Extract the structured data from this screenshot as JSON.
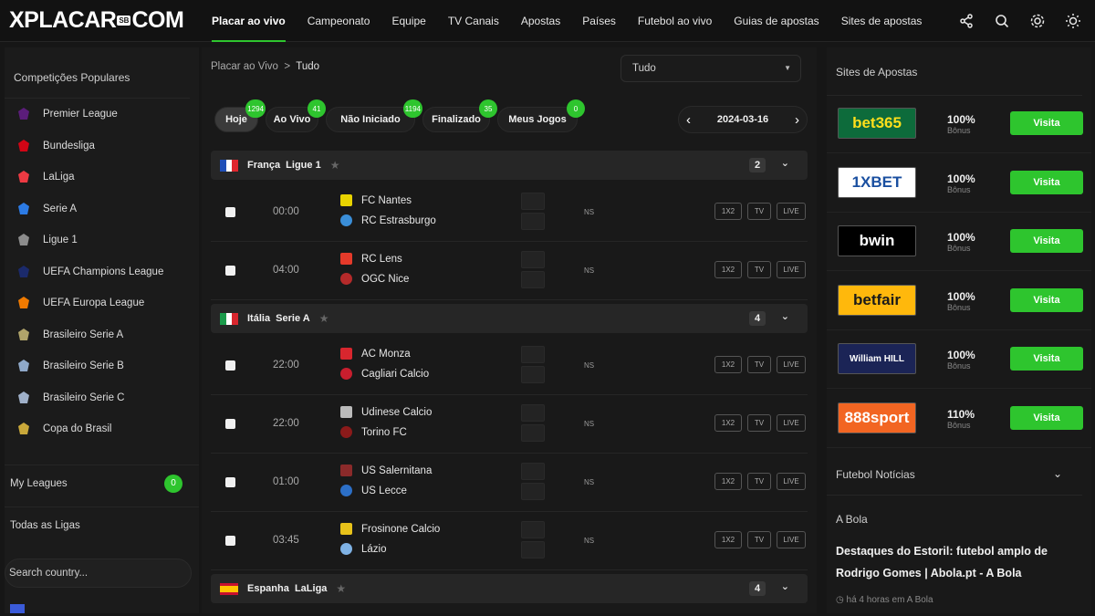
{
  "header": {
    "logo": {
      "part1": "XPLACAR",
      "badge": "SB",
      "part2": "COM"
    },
    "nav": [
      {
        "label": "Placar ao vivo",
        "active": true
      },
      {
        "label": "Campeonato"
      },
      {
        "label": "Equipe"
      },
      {
        "label": "TV Canais"
      },
      {
        "label": "Apostas"
      },
      {
        "label": "Países"
      },
      {
        "label": "Futebol ao vivo"
      },
      {
        "label": "Guias de apostas"
      },
      {
        "label": "Sites de apostas"
      }
    ],
    "icons": [
      "share-icon",
      "search-icon",
      "gear-icon",
      "sun-icon"
    ]
  },
  "sidebar": {
    "title": "Competições Populares",
    "competitions": [
      {
        "label": "Premier League",
        "icon": "premier-league-icon",
        "color": "#5b1d7a"
      },
      {
        "label": "Bundesliga",
        "icon": "bundesliga-icon",
        "color": "#d20515"
      },
      {
        "label": "LaLiga",
        "icon": "laliga-icon",
        "color": "#ee3a43"
      },
      {
        "label": "Serie A",
        "icon": "serie-a-icon",
        "color": "#2c7be5"
      },
      {
        "label": "Ligue 1",
        "icon": "ligue-1-icon",
        "color": "#8c8c8c"
      },
      {
        "label": "UEFA Champions League",
        "icon": "champions-league-icon",
        "color": "#1b2a6b"
      },
      {
        "label": "UEFA Europa League",
        "icon": "europa-league-icon",
        "color": "#f07a00"
      },
      {
        "label": "Brasileiro Serie A",
        "icon": "brasileiro-a-icon",
        "color": "#b0a46a"
      },
      {
        "label": "Brasileiro Serie B",
        "icon": "brasileiro-b-icon",
        "color": "#8fa9c9"
      },
      {
        "label": "Brasileiro Serie C",
        "icon": "brasileiro-c-icon",
        "color": "#9fb0c9"
      },
      {
        "label": "Copa do Brasil",
        "icon": "copa-do-brasil-icon",
        "color": "#c9a83a"
      }
    ],
    "my_leagues": {
      "label": "My Leagues",
      "count": "0"
    },
    "all_leagues": "Todas as Ligas",
    "search_placeholder": "Search country..."
  },
  "main": {
    "breadcrumb": {
      "root": "Placar ao Vivo",
      "separator": ">",
      "current": "Tudo"
    },
    "select_value": "Tudo",
    "filters": [
      {
        "label": "Hoje",
        "count": "1294",
        "active": true
      },
      {
        "label": "Ao Vivo",
        "count": "41"
      },
      {
        "label": "Não Iniciado",
        "count": "1194"
      },
      {
        "label": "Finalizado",
        "count": "35"
      },
      {
        "label": "Meus Jogos",
        "count": "0"
      }
    ],
    "date": "2024-03-16",
    "status_ns": "NS",
    "match_buttons": [
      "1X2",
      "TV",
      "LIVE"
    ],
    "leagues": [
      {
        "name": "França  Ligue 1",
        "count": "2",
        "flag": "france-flag",
        "matches": [
          {
            "time": "00:00",
            "home": "FC Nantes",
            "away": "RC Estrasburgo",
            "home_color": "#e8d300",
            "away_color": "#3a8ed8"
          },
          {
            "time": "04:00",
            "home": "RC Lens",
            "away": "OGC Nice",
            "home_color": "#e53a2a",
            "away_color": "#b52a2a"
          }
        ]
      },
      {
        "name": "Itália  Serie A",
        "count": "4",
        "flag": "italy-flag",
        "matches": [
          {
            "time": "22:00",
            "home": "AC Monza",
            "away": "Cagliari Calcio",
            "home_color": "#d8262e",
            "away_color": "#c81e2e"
          },
          {
            "time": "22:00",
            "home": "Udinese Calcio",
            "away": "Torino FC",
            "home_color": "#bbbbbb",
            "away_color": "#8b1a1a"
          },
          {
            "time": "01:00",
            "home": "US Salernitana",
            "away": "US Lecce",
            "home_color": "#8b2a2a",
            "away_color": "#2c6fc7"
          },
          {
            "time": "03:45",
            "home": "Frosinone Calcio",
            "away": "Lázio",
            "home_color": "#e8c21a",
            "away_color": "#7fb2e5"
          }
        ]
      },
      {
        "name": "Espanha  LaLiga",
        "count": "4",
        "flag": "spain-flag",
        "matches": []
      }
    ]
  },
  "right": {
    "title": "Sites de Apostas",
    "bookmakers": [
      {
        "name": "bet365",
        "percent": "100%",
        "sub": "Bônus",
        "visit": "Visita",
        "bg": "#0d6b3b",
        "fg": "#ffdf1b"
      },
      {
        "name": "1XBET",
        "percent": "100%",
        "sub": "Bônus",
        "visit": "Visita",
        "bg": "#ffffff",
        "fg": "#1a4fa0"
      },
      {
        "name": "bwin",
        "percent": "100%",
        "sub": "Bônus",
        "visit": "Visita",
        "bg": "#000000",
        "fg": "#ffffff"
      },
      {
        "name": "betfair",
        "percent": "100%",
        "sub": "Bônus",
        "visit": "Visita",
        "bg": "#ffb80c",
        "fg": "#1a1a1a"
      },
      {
        "name": "William HILL",
        "percent": "100%",
        "sub": "Bônus",
        "visit": "Visita",
        "bg": "#1b2456",
        "fg": "#ffffff"
      },
      {
        "name": "888sport",
        "percent": "110%",
        "sub": "Bônus",
        "visit": "Visita",
        "bg": "#f26522",
        "fg": "#ffffff"
      }
    ],
    "news_header": "Futebol Notícias",
    "news_source": "A Bola",
    "news_title": "Destaques do Estoril: futebol amplo de Rodrigo Gomes | Abola.pt - A Bola",
    "news_meta": "há 4 horas em A Bola"
  },
  "colors": {
    "accent": "#2ec52e",
    "background": "#161616",
    "panel": "#1b1b1b"
  }
}
